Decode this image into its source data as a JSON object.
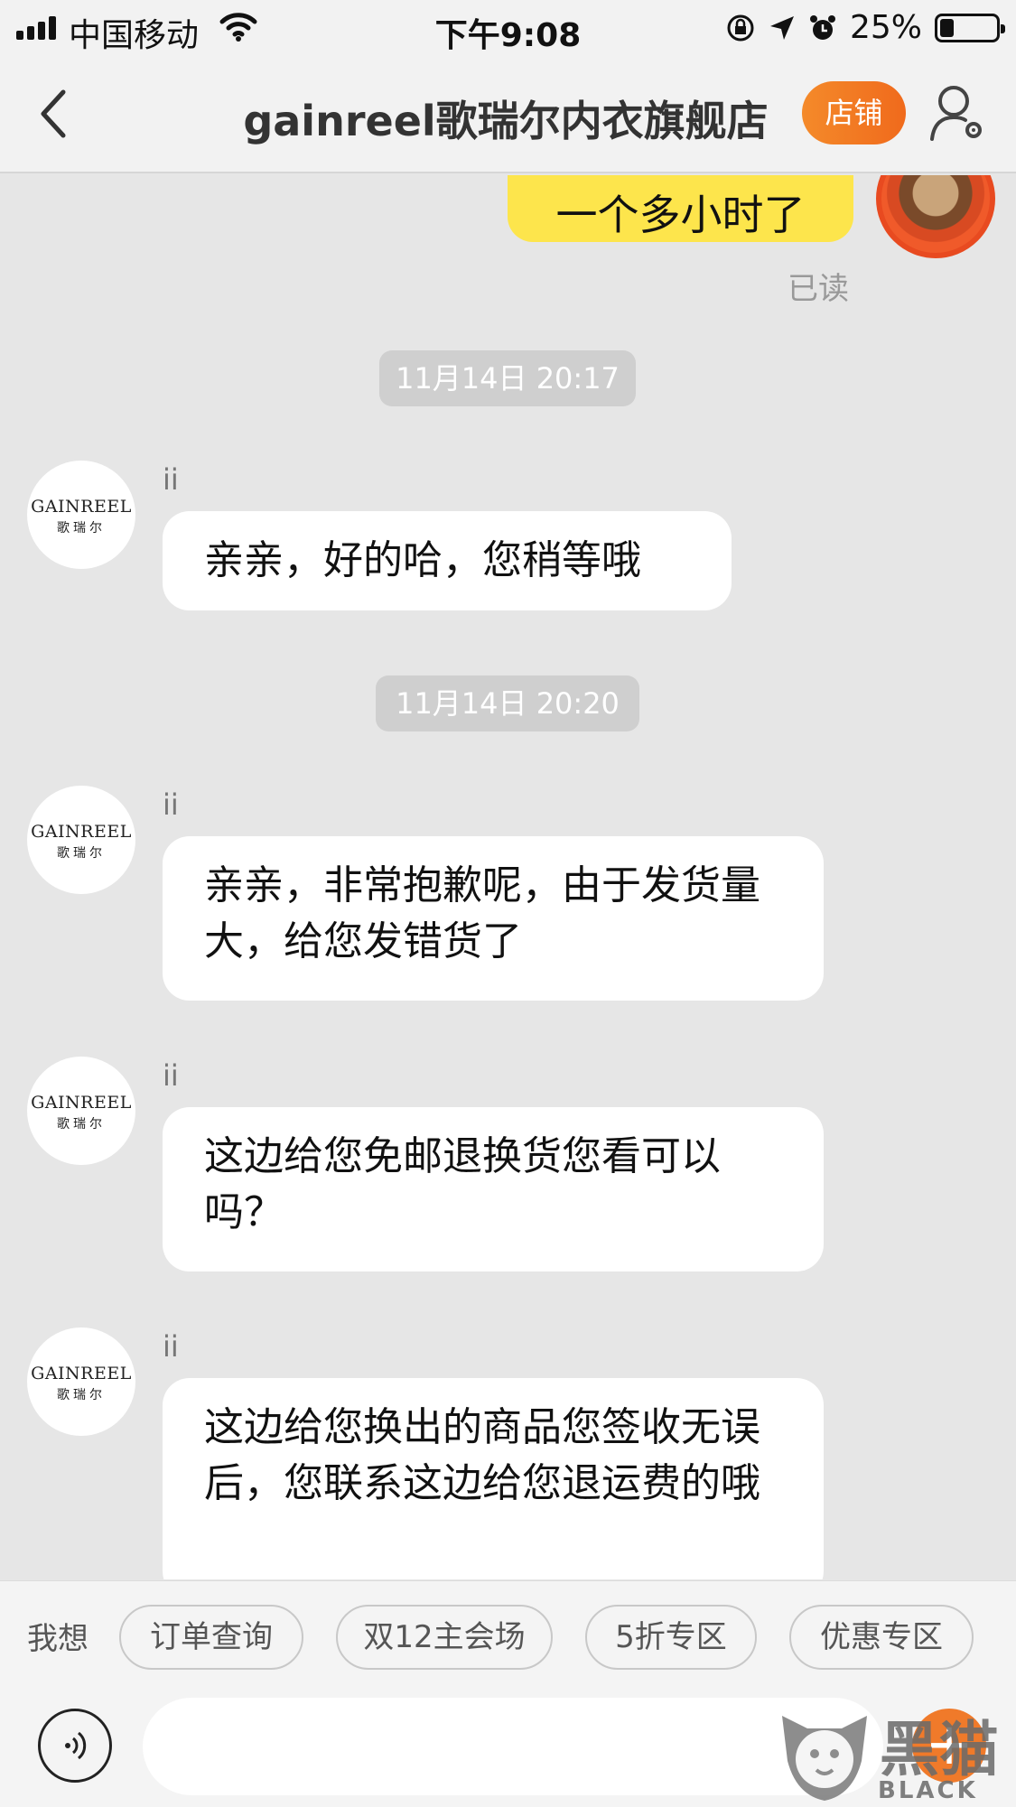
{
  "status_bar": {
    "carrier": "中国移动",
    "time": "下午9:08",
    "battery": "25%",
    "battery_level": 0.25
  },
  "nav": {
    "title": "gainreel歌瑞尔内衣旗舰店",
    "shop_button": "店铺"
  },
  "chat": {
    "self_message": "一个多小时了",
    "read_status": "已读",
    "shop_avatar_brand": "GAINREEL",
    "shop_avatar_brand_cn": "歌瑞尔",
    "timestamps": [
      "11月14日 20:17",
      "11月14日 20:20"
    ],
    "messages": [
      {
        "sender": "ii",
        "text": "亲亲，好的哈，您稍等哦"
      },
      {
        "sender": "ii",
        "text": "亲亲，非常抱歉呢，由于发货量大，给您发错货了"
      },
      {
        "sender": "ii",
        "text": "这边给您免邮退换货您看可以吗？"
      },
      {
        "sender": "ii",
        "text": "这边给您换出的商品您签收无误后，您联系这边给您退运费的哦"
      }
    ]
  },
  "quick_replies": {
    "label": "我想",
    "chips": [
      "订单查询",
      "双12主会场",
      "5折专区",
      "优惠专区"
    ]
  },
  "input": {
    "placeholder": "",
    "plus": "+"
  },
  "watermark": {
    "text": "黑猫",
    "sub": "BLACK CAT"
  },
  "colors": {
    "self_bubble": "#fde54c",
    "accent": "#f06a1c",
    "chat_background": "#e6e6e6"
  }
}
